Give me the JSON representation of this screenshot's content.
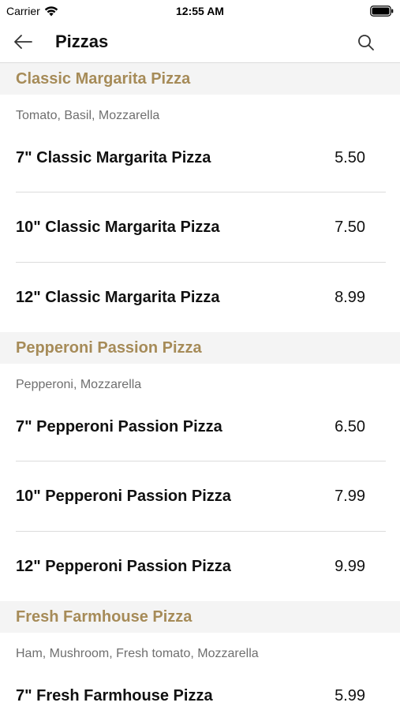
{
  "status_bar": {
    "carrier": "Carrier",
    "time": "12:55 AM",
    "wifi_icon": "wifi-icon",
    "battery_icon": "battery-icon"
  },
  "nav": {
    "title": "Pizzas",
    "back_icon": "arrow-left-icon",
    "search_icon": "search-icon"
  },
  "colors": {
    "section_title": "#a68b58",
    "section_bg": "#f4f4f4",
    "description": "#6f6f6f",
    "divider": "#dcdcdc"
  },
  "sections": [
    {
      "title": "Classic Margarita Pizza",
      "description": "Tomato, Basil, Mozzarella",
      "items": [
        {
          "name": "7\" Classic Margarita Pizza",
          "price": "5.50"
        },
        {
          "name": "10\" Classic Margarita Pizza",
          "price": "7.50"
        },
        {
          "name": "12\" Classic Margarita Pizza",
          "price": "8.99"
        }
      ]
    },
    {
      "title": "Pepperoni Passion Pizza",
      "description": "Pepperoni, Mozzarella",
      "items": [
        {
          "name": "7\" Pepperoni Passion Pizza",
          "price": "6.50"
        },
        {
          "name": "10\" Pepperoni Passion Pizza",
          "price": "7.99"
        },
        {
          "name": "12\" Pepperoni Passion Pizza",
          "price": "9.99"
        }
      ]
    },
    {
      "title": "Fresh Farmhouse Pizza",
      "description": "Ham, Mushroom, Fresh tomato, Mozzarella",
      "items": [
        {
          "name": "7\" Fresh Farmhouse Pizza",
          "price": "5.99"
        }
      ]
    }
  ]
}
